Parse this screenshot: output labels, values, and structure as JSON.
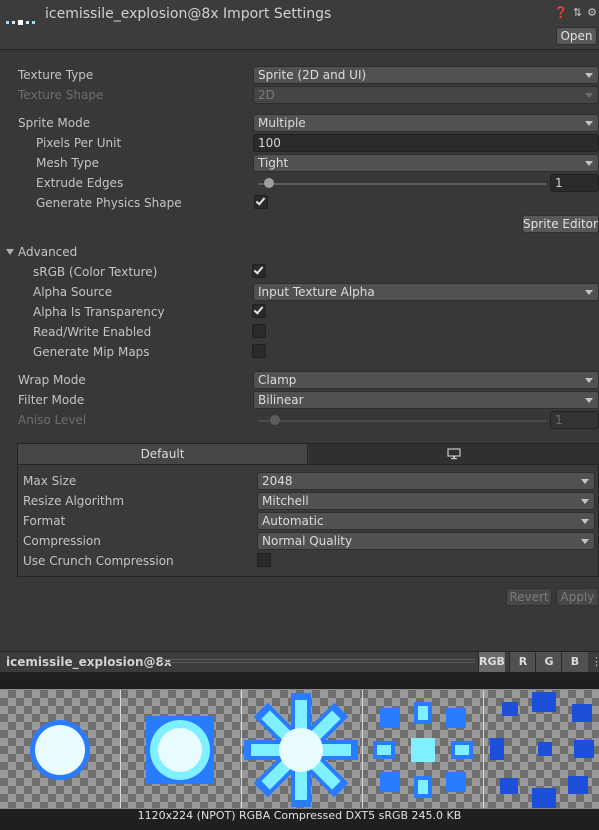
{
  "header": {
    "title": "icemissile_explosion@8x Import Settings",
    "open_label": "Open",
    "icons": [
      "help-icon",
      "preset-icon",
      "settings-icon"
    ]
  },
  "fields": {
    "texture_type": {
      "label": "Texture Type",
      "value": "Sprite (2D and UI)"
    },
    "texture_shape": {
      "label": "Texture Shape",
      "value": "2D"
    },
    "sprite_mode": {
      "label": "Sprite Mode",
      "value": "Multiple"
    },
    "pixels_per_unit": {
      "label": "Pixels Per Unit",
      "value": "100"
    },
    "mesh_type": {
      "label": "Mesh Type",
      "value": "Tight"
    },
    "extrude_edges": {
      "label": "Extrude Edges",
      "value": "1",
      "slider_fraction": 0.04
    },
    "generate_physics_shape": {
      "label": "Generate Physics Shape",
      "checked": true
    },
    "sprite_editor_label": "Sprite Editor"
  },
  "advanced": {
    "label": "Advanced",
    "srgb": {
      "label": "sRGB (Color Texture)",
      "checked": true
    },
    "alpha_source": {
      "label": "Alpha Source",
      "value": "Input Texture Alpha"
    },
    "alpha_is_transparency": {
      "label": "Alpha Is Transparency",
      "checked": true
    },
    "read_write": {
      "label": "Read/Write Enabled",
      "checked": false
    },
    "mip_maps": {
      "label": "Generate Mip Maps",
      "checked": false
    }
  },
  "wrap": {
    "wrap_mode": {
      "label": "Wrap Mode",
      "value": "Clamp"
    },
    "filter_mode": {
      "label": "Filter Mode",
      "value": "Bilinear"
    },
    "aniso_level": {
      "label": "Aniso Level",
      "value": "1"
    }
  },
  "platform": {
    "tab_default": "Default",
    "tab_standalone_icon": "monitor-icon",
    "max_size": {
      "label": "Max Size",
      "value": "2048"
    },
    "resize_algorithm": {
      "label": "Resize Algorithm",
      "value": "Mitchell"
    },
    "format": {
      "label": "Format",
      "value": "Automatic"
    },
    "compression": {
      "label": "Compression",
      "value": "Normal Quality"
    },
    "crunch": {
      "label": "Use Crunch Compression",
      "checked": false
    }
  },
  "actions": {
    "revert": "Revert",
    "apply": "Apply"
  },
  "preview": {
    "name": "icemissile_explosion@8x",
    "channels": [
      "RGB",
      "R",
      "G",
      "B"
    ],
    "info": "1120x224 (NPOT)  RGBA Compressed DXT5 sRGB  245.0 KB"
  },
  "colors": {
    "ice_light": "#e8fbff",
    "ice_cyan": "#7ff0ff",
    "ice_blue": "#2a7cff",
    "ice_deep": "#1e4fd8"
  }
}
